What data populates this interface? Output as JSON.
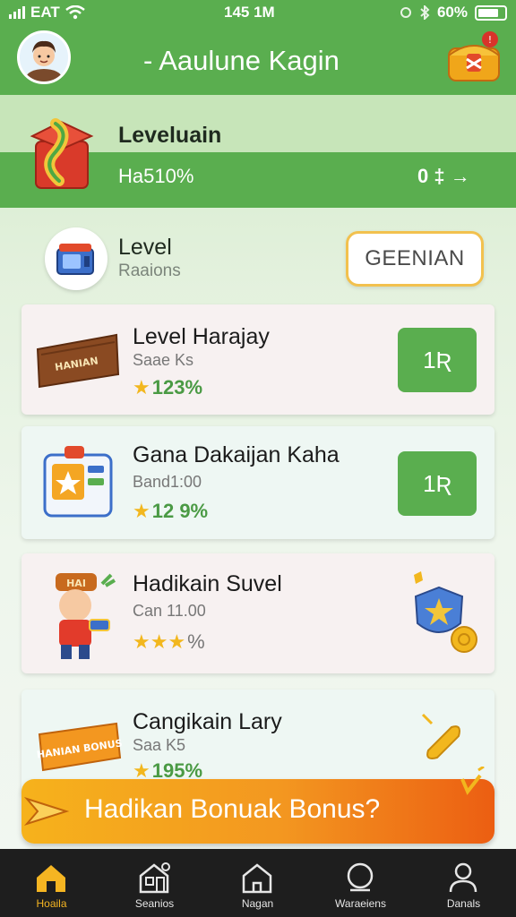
{
  "status_bar": {
    "carrier": "EAT",
    "time": "145 1M",
    "battery": "60%"
  },
  "header": {
    "title": "- Aaulune Kagin"
  },
  "level_banner": {
    "title": "Leveluain",
    "percent": "Ha510%",
    "actions": "0 ‡ →"
  },
  "level_section": {
    "label": "Level",
    "sublabel": "Raaions",
    "button_label": "GEENIAN"
  },
  "cards": [
    {
      "title": "Level Harajay",
      "subtitle": "Saae Ks",
      "stars": "★",
      "value": "123%",
      "action": "1Ʀ",
      "badge_text": "HANIAN",
      "background": "#f7f1f1"
    },
    {
      "title": "Gana Dakaijan Kaha",
      "subtitle": "Band1:00",
      "stars": "★",
      "value": "12 9%",
      "action": "1Ʀ",
      "background": "#eef7f3"
    },
    {
      "title": "Hadikain Suvel",
      "subtitle": "Can 11.00",
      "stars": "★★★",
      "value": "%",
      "background": "#f7f1f1"
    },
    {
      "title": "Cangikain Lary",
      "subtitle": "Saa K5",
      "stars": "★",
      "value": "195%",
      "badge_text": "HANIAN BONUS",
      "background": "#eef7f3"
    }
  ],
  "bonus_bar": {
    "label": "Hadikan Bonuak Bonus?"
  },
  "bottom_nav": [
    {
      "label": "Hoaila",
      "icon": "home-icon",
      "active": true
    },
    {
      "label": "Seanios",
      "icon": "store-icon",
      "active": false
    },
    {
      "label": "Nagan",
      "icon": "house-icon",
      "active": false
    },
    {
      "label": "Waraeiens",
      "icon": "search-icon",
      "active": false
    },
    {
      "label": "Danals",
      "icon": "profile-icon",
      "active": false
    }
  ],
  "colors": {
    "primary_green": "#5aae4f",
    "accent_orange": "#f39720",
    "nav_active": "#f5b522"
  }
}
